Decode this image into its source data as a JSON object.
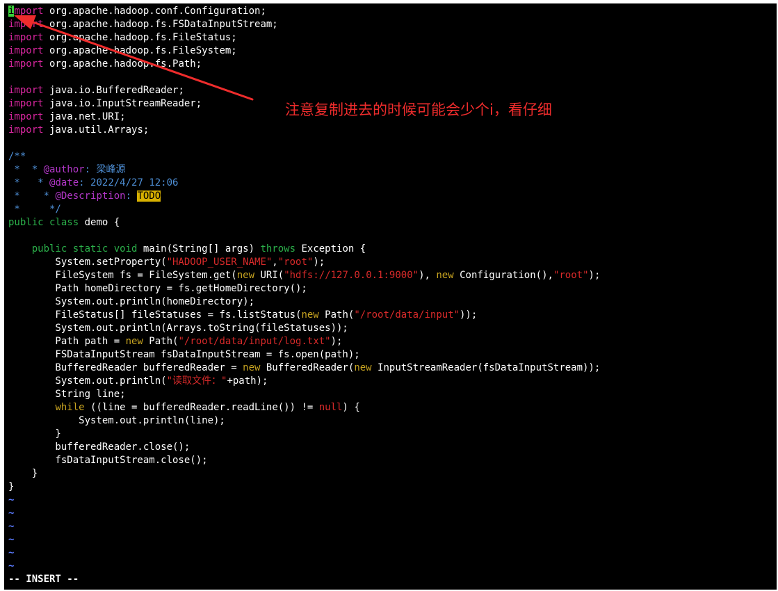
{
  "editor": {
    "mode_label": "-- INSERT --",
    "empty_line_marker": "~",
    "empty_line_count": 6,
    "colors": {
      "background": "#000000",
      "keyword": "#d7269e",
      "type": "#2bb04a",
      "flow": "#c8a421",
      "string": "#d82a2a",
      "comment": "#4e8fd6",
      "comment_tag": "#b237c8",
      "cursor": "#3ad03a",
      "todo_highlight": "#d7b000",
      "tilde": "#5b7bff"
    },
    "code_lines": [
      [
        [
          "cur",
          "i"
        ],
        [
          "kw",
          "mport"
        ],
        [
          "plain",
          " org.apache.hadoop.conf.Configuration;"
        ]
      ],
      [
        [
          "kw",
          "import"
        ],
        [
          "plain",
          " org.apache.hadoop.fs.FSDataInputStream;"
        ]
      ],
      [
        [
          "kw",
          "import"
        ],
        [
          "plain",
          " org.apache.hadoop.fs.FileStatus;"
        ]
      ],
      [
        [
          "kw",
          "import"
        ],
        [
          "plain",
          " org.apache.hadoop.fs.FileSystem;"
        ]
      ],
      [
        [
          "kw",
          "import"
        ],
        [
          "plain",
          " org.apache.hadoop.fs.Path;"
        ]
      ],
      [],
      [
        [
          "kw",
          "import"
        ],
        [
          "plain",
          " java.io.BufferedReader;"
        ]
      ],
      [
        [
          "kw",
          "import"
        ],
        [
          "plain",
          " java.io.InputStreamReader;"
        ]
      ],
      [
        [
          "kw",
          "import"
        ],
        [
          "plain",
          " java.net.URI;"
        ]
      ],
      [
        [
          "kw",
          "import"
        ],
        [
          "plain",
          " java.util.Arrays;"
        ]
      ],
      [],
      [
        [
          "cm",
          "/**"
        ]
      ],
      [
        [
          "cm",
          " *  * "
        ],
        [
          "cm2",
          "@author"
        ],
        [
          "cm",
          ": 梁峰源"
        ]
      ],
      [
        [
          "cm",
          " *   * "
        ],
        [
          "cm2",
          "@date"
        ],
        [
          "cm",
          ": 2022/4/27 12:06"
        ]
      ],
      [
        [
          "cm",
          " *    * "
        ],
        [
          "cm2",
          "@Description"
        ],
        [
          "cm",
          ": "
        ],
        [
          "todo",
          "TODO"
        ]
      ],
      [
        [
          "cm",
          " *     */"
        ]
      ],
      [
        [
          "ty",
          "public class"
        ],
        [
          "plain",
          " demo {"
        ]
      ],
      [],
      [
        [
          "plain",
          "    "
        ],
        [
          "ty",
          "public static void"
        ],
        [
          "plain",
          " main(String[] args) "
        ],
        [
          "ty",
          "throws"
        ],
        [
          "plain",
          " Exception {"
        ]
      ],
      [
        [
          "plain",
          "        System.setProperty("
        ],
        [
          "str",
          "\"HADOOP_USER_NAME\""
        ],
        [
          "plain",
          ","
        ],
        [
          "str",
          "\"root\""
        ],
        [
          "plain",
          ");"
        ]
      ],
      [
        [
          "plain",
          "        FileSystem fs = FileSystem.get("
        ],
        [
          "kw2",
          "new"
        ],
        [
          "plain",
          " URI("
        ],
        [
          "str",
          "\"hdfs://127.0.0.1:9000\""
        ],
        [
          "plain",
          "), "
        ],
        [
          "kw2",
          "new"
        ],
        [
          "plain",
          " Configuration(),"
        ],
        [
          "str",
          "\"root\""
        ],
        [
          "plain",
          ");"
        ]
      ],
      [
        [
          "plain",
          "        Path homeDirectory = fs.getHomeDirectory();"
        ]
      ],
      [
        [
          "plain",
          "        System.out.println(homeDirectory);"
        ]
      ],
      [
        [
          "plain",
          "        FileStatus[] fileStatuses = fs.listStatus("
        ],
        [
          "kw2",
          "new"
        ],
        [
          "plain",
          " Path("
        ],
        [
          "str",
          "\"/root/data/input\""
        ],
        [
          "plain",
          "));"
        ]
      ],
      [
        [
          "plain",
          "        System.out.println(Arrays.toString(fileStatuses));"
        ]
      ],
      [
        [
          "plain",
          "        Path path = "
        ],
        [
          "kw2",
          "new"
        ],
        [
          "plain",
          " Path("
        ],
        [
          "str",
          "\"/root/data/input/log.txt\""
        ],
        [
          "plain",
          ");"
        ]
      ],
      [
        [
          "plain",
          "        FSDataInputStream fsDataInputStream = fs.open(path);"
        ]
      ],
      [
        [
          "plain",
          "        BufferedReader bufferedReader = "
        ],
        [
          "kw2",
          "new"
        ],
        [
          "plain",
          " BufferedReader("
        ],
        [
          "kw2",
          "new"
        ],
        [
          "plain",
          " InputStreamReader(fsDataInputStream));"
        ]
      ],
      [
        [
          "plain",
          "        System.out.println("
        ],
        [
          "str",
          "\"读取文件：\""
        ],
        [
          "plain",
          "+path);"
        ]
      ],
      [
        [
          "plain",
          "        String line;"
        ]
      ],
      [
        [
          "plain",
          "        "
        ],
        [
          "kw2",
          "while"
        ],
        [
          "plain",
          " ((line = bufferedReader.readLine()) != "
        ],
        [
          "str",
          "null"
        ],
        [
          "plain",
          ") {"
        ]
      ],
      [
        [
          "plain",
          "            System.out.println(line);"
        ]
      ],
      [
        [
          "plain",
          "        }"
        ]
      ],
      [
        [
          "plain",
          "        bufferedReader.close();"
        ]
      ],
      [
        [
          "plain",
          "        fsDataInputStream.close();"
        ]
      ],
      [
        [
          "plain",
          "    }"
        ]
      ],
      [
        [
          "plain",
          "}"
        ]
      ]
    ]
  },
  "annotation": {
    "note_text": "注意复制进去的时候可能会少个i，看仔细",
    "arrow_color": "#ee2c2c"
  }
}
